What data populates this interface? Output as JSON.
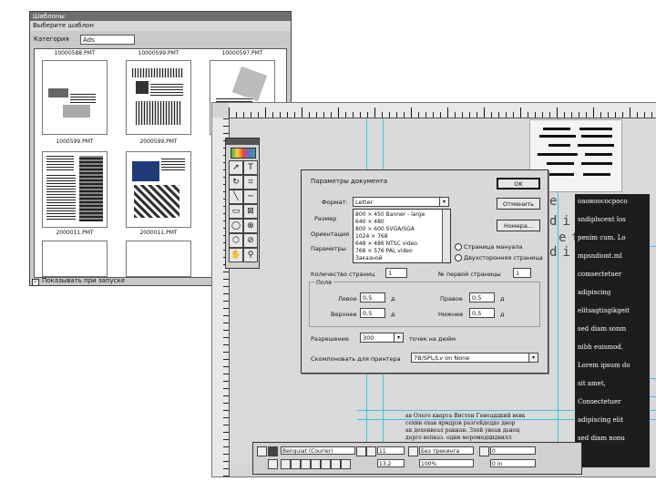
{
  "gallery": {
    "title": "Шаблоны",
    "menu": "Выберите шаблон",
    "category_label": "Категория",
    "category_value": "Ads",
    "thumbnails": [
      {
        "caption": "10000588.PMT"
      },
      {
        "caption": "10000599.PMT"
      },
      {
        "caption": "10000597.PMT"
      },
      {
        "caption": "1000599.PMT"
      },
      {
        "caption": "2000599.PMT"
      },
      {
        "caption": ""
      },
      {
        "caption": "2000011.PMT"
      },
      {
        "caption": "2000011.PMT"
      },
      {
        "caption": ""
      }
    ],
    "show_at_startup": "Показывать при запуске",
    "show_at_startup_checked": "✓"
  },
  "editor": {
    "side_letters": [
      "e",
      "dit",
      "et",
      "dio"
    ],
    "dark_column_lines": [
      "оаоиоососросо",
      "sndiplscent los",
      "penim cum. Lo",
      "mpsndiont.ml",
      "comsectetuer",
      "adipiscing",
      "elitsagtisgikgeit",
      "sed diam sonm",
      "nibh euismod.",
      "Lorem ipsum do",
      "sit amet,",
      "Consectetuer",
      "adipiscing elit",
      "sed diam nonu"
    ],
    "bottom_text": [
      "ав Олеге кварта Вистен Генеадцкий вевк",
      "сехин ехав ярндрзв разгейдеддо днор",
      "ак дехенвеал ракнан. Злей увеак дьноц",
      "дерго вепказ. одни моромедцидвилл"
    ]
  },
  "control_palette": {
    "font": "Benguiat (Courier)",
    "size": "11",
    "leading": "13,2",
    "tracking": "Без трекинга",
    "width": "100%",
    "v1": "0",
    "v2": "0 in"
  },
  "dialog": {
    "title": "Параметры документа",
    "format_label": "Формат:",
    "format_value": "Letter",
    "size_label": "Размер",
    "orientation_label": "Ориентация",
    "params_label": "Параметры",
    "format_options": [
      "800 × 450 Banner - large",
      "640 × 480",
      "800 × 600 SVGA/SGA",
      "1024 × 768",
      "648 × 486 NTSC video",
      "768 × 576 PAL video",
      "Заказной"
    ],
    "checkbox_facing": "Страница мануала",
    "checkbox_double": "Двухсторонняя страница",
    "ok": "OK",
    "cancel": "Отменить",
    "numbers": "Номера...",
    "pages_label": "Количество страниц",
    "pages_value": "1",
    "first_page_label": "№ первой страницы",
    "first_page_value": "1",
    "margins_label": "Поля",
    "inside_label": "Левое",
    "inside_value": "0,5",
    "inside_unit": "д",
    "top_label": "Верхнее",
    "top_value": "0,5",
    "top_unit": "д",
    "outside_label": "Правое",
    "outside_value": "0,5",
    "outside_unit": "д",
    "bottom_label": "Нижнее",
    "bottom_value": "0,5",
    "bottom_unit": "д",
    "resolution_label": "Разрешение",
    "resolution_value": "300",
    "resolution_unit": "точек на дюйм",
    "printer_label": "Скомпоновать для принтера",
    "printer_value": "7B/SPL/Lv on None"
  }
}
